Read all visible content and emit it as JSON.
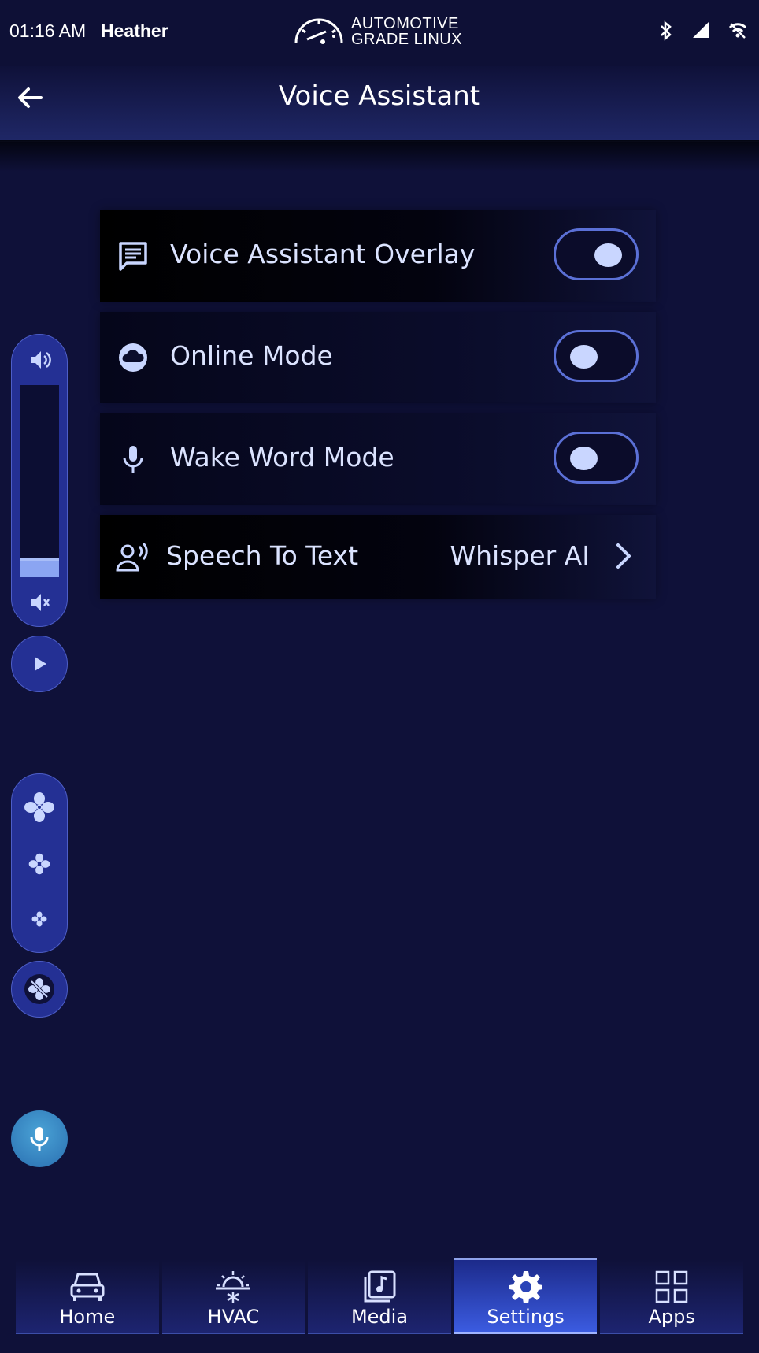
{
  "status_bar": {
    "time": "01:16 AM",
    "user": "Heather",
    "brand_line1": "AUTOMOTIVE",
    "brand_line2": "GRADE LINUX",
    "icons": [
      "bluetooth-icon",
      "signal-icon",
      "wifi-off-icon"
    ]
  },
  "header": {
    "title": "Voice Assistant",
    "back_icon": "arrow-left-icon"
  },
  "settings": {
    "overlay": {
      "label": "Voice Assistant Overlay",
      "icon": "message-icon",
      "enabled": true
    },
    "online": {
      "label": "Online Mode",
      "icon": "cloud-icon",
      "enabled": false
    },
    "wake_word": {
      "label": "Wake Word Mode",
      "icon": "microphone-icon",
      "enabled": false
    },
    "speech_to_text": {
      "label": "Speech To Text",
      "icon": "voice-user-icon",
      "value": "Whisper AI"
    }
  },
  "side_controls": {
    "volume_level": 0.1,
    "icons": [
      "volume-up-icon",
      "volume-down-icon",
      "play-icon",
      "fan-high-icon",
      "fan-medium-icon",
      "fan-low-icon",
      "fan-off-icon",
      "mic-icon"
    ]
  },
  "bottom_nav": {
    "items": [
      {
        "label": "Home",
        "icon": "car-icon"
      },
      {
        "label": "HVAC",
        "icon": "sun-snow-icon"
      },
      {
        "label": "Media",
        "icon": "music-icon"
      },
      {
        "label": "Settings",
        "icon": "gear-icon",
        "active": true
      },
      {
        "label": "Apps",
        "icon": "grid-icon"
      }
    ]
  },
  "colors": {
    "background": "#0f1139",
    "accent": "#3b5be0",
    "toggle_border": "#5b70d6",
    "text": "#dbe3ff"
  }
}
